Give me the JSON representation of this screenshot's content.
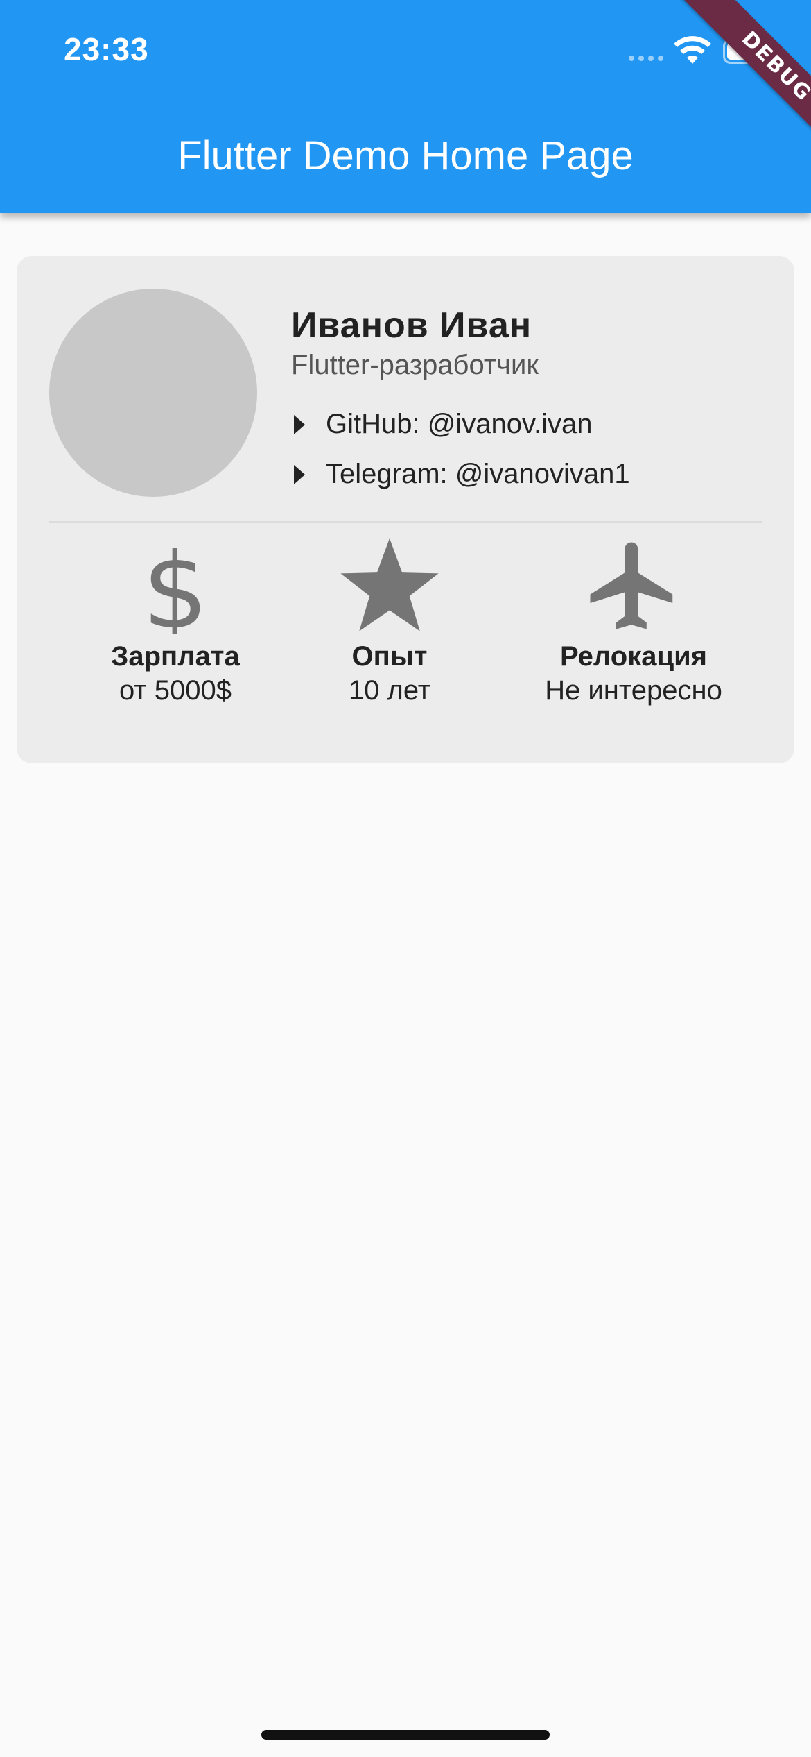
{
  "status_bar": {
    "time": "23:33"
  },
  "app_bar": {
    "title": "Flutter Demo Home Page",
    "color": "#2196f3"
  },
  "debug_banner": {
    "label": "DEBUG"
  },
  "profile": {
    "name": "Иванов Иван",
    "role": "Flutter-разработчик",
    "links": [
      {
        "label": "GitHub: @ivanov.ivan"
      },
      {
        "label": "Telegram: @ivanovivan1"
      }
    ]
  },
  "stats": [
    {
      "icon": "dollar-icon",
      "title": "Зарплата",
      "value": "от 5000$"
    },
    {
      "icon": "star-icon",
      "title": "Опыт",
      "value": "10 лет"
    },
    {
      "icon": "airplane-icon",
      "title": "Релокация",
      "value": "Не интересно"
    }
  ]
}
